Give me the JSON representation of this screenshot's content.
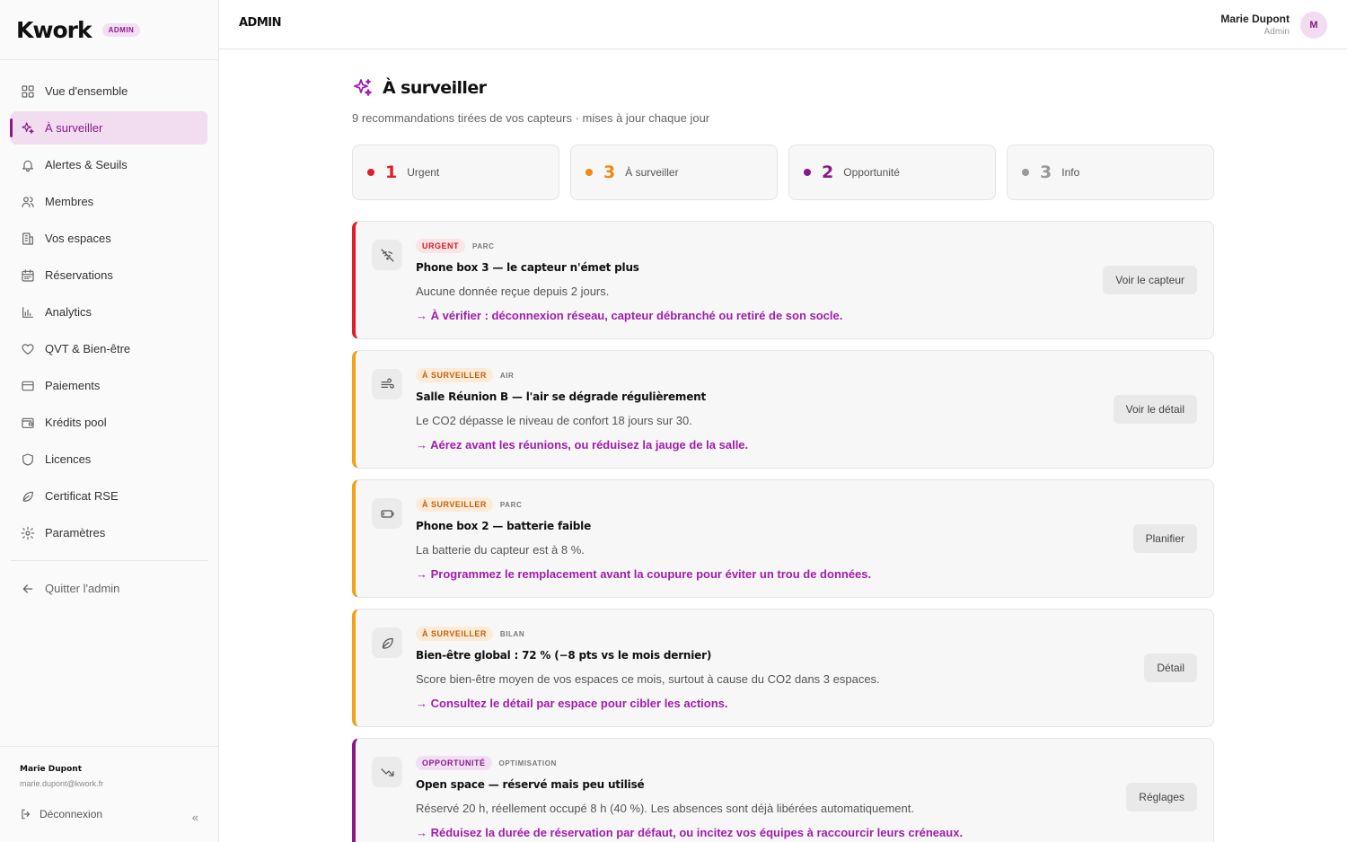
{
  "brand": {
    "logo": "Kwork",
    "badge": "ADMIN"
  },
  "sidebar": {
    "items": [
      {
        "label": "Vue d'ensemble",
        "icon": "grid-icon"
      },
      {
        "label": "À surveiller",
        "icon": "sparkles-icon",
        "active": true
      },
      {
        "label": "Alertes & Seuils",
        "icon": "bell-icon"
      },
      {
        "label": "Membres",
        "icon": "users-icon"
      },
      {
        "label": "Vos espaces",
        "icon": "building-icon"
      },
      {
        "label": "Réservations",
        "icon": "calendar-icon"
      },
      {
        "label": "Analytics",
        "icon": "bar-chart-icon"
      },
      {
        "label": "QVT & Bien-être",
        "icon": "heart-icon"
      },
      {
        "label": "Paiements",
        "icon": "credit-card-icon"
      },
      {
        "label": "Krédits pool",
        "icon": "wallet-icon"
      },
      {
        "label": "Licences",
        "icon": "shield-icon"
      },
      {
        "label": "Certificat RSE",
        "icon": "leaf-icon"
      },
      {
        "label": "Paramètres",
        "icon": "gear-icon"
      }
    ],
    "quit": "Quitter l'admin",
    "footer": {
      "name": "Marie Dupont",
      "email": "marie.dupont@kwork.fr",
      "logout": "Déconnexion",
      "collapse": "«"
    }
  },
  "topbar": {
    "title": "ADMIN",
    "user_name": "Marie Dupont",
    "user_role": "Admin",
    "avatar": "M"
  },
  "page": {
    "title": "À surveiller",
    "subtitle": "9 recommandations tirées de vos capteurs · mises à jour chaque jour"
  },
  "stats": [
    {
      "count": "1",
      "label": "Urgent",
      "color": "#e11d2a"
    },
    {
      "count": "3",
      "label": "À surveiller",
      "color": "#f08a12"
    },
    {
      "count": "2",
      "label": "Opportunité",
      "color": "#8a1a8a"
    },
    {
      "count": "3",
      "label": "Info",
      "color": "#999999"
    }
  ],
  "cards": [
    {
      "tag": "URGENT",
      "tag_bg": "#fde4e4",
      "tag_color": "#d11a2a",
      "accent": "#e11d2a",
      "category": "PARC",
      "icon": "wifi-off-icon",
      "title": "Phone box 3 — le capteur n'émet plus",
      "desc": "Aucune donnée reçue depuis 2 jours.",
      "action": "→ À vérifier : déconnexion réseau, capteur débranché ou retiré de son socle.",
      "button": "Voir le capteur"
    },
    {
      "tag": "À SURVEILLER",
      "tag_bg": "#fdebd7",
      "tag_color": "#c2610c",
      "accent": "#f0a31a",
      "category": "AIR",
      "icon": "wind-icon",
      "title": "Salle Réunion B — l'air se dégrade régulièrement",
      "desc": "Le CO2 dépasse le niveau de confort 18 jours sur 30.",
      "action": "→ Aérez avant les réunions, ou réduisez la jauge de la salle.",
      "button": "Voir le détail"
    },
    {
      "tag": "À SURVEILLER",
      "tag_bg": "#fdebd7",
      "tag_color": "#c2610c",
      "accent": "#f0a31a",
      "category": "PARC",
      "icon": "battery-low-icon",
      "title": "Phone box 2 — batterie faible",
      "desc": "La batterie du capteur est à 8 %.",
      "action": "→ Programmez le remplacement avant la coupure pour éviter un trou de données.",
      "button": "Planifier"
    },
    {
      "tag": "À SURVEILLER",
      "tag_bg": "#fdebd7",
      "tag_color": "#c2610c",
      "accent": "#f0a31a",
      "category": "BILAN",
      "icon": "leaf-icon",
      "title": "Bien-être global : 72 % (−8 pts vs le mois dernier)",
      "desc": "Score bien-être moyen de vos espaces ce mois, surtout à cause du CO2 dans 3 espaces.",
      "action": "→ Consultez le détail par espace pour cibler les actions.",
      "button": "Détail"
    },
    {
      "tag": "OPPORTUNITÉ",
      "tag_bg": "#f3dff3",
      "tag_color": "#8a1a8a",
      "accent": "#8a1a8a",
      "category": "OPTIMISATION",
      "icon": "trending-down-icon",
      "title": "Open space — réservé mais peu utilisé",
      "desc": "Réservé 20 h, réellement occupé 8 h (40 %). Les absences sont déjà libérées automatiquement.",
      "action": "→ Réduisez la durée de réservation par défaut, ou incitez vos équipes à raccourcir leurs créneaux.",
      "button": "Réglages"
    }
  ]
}
